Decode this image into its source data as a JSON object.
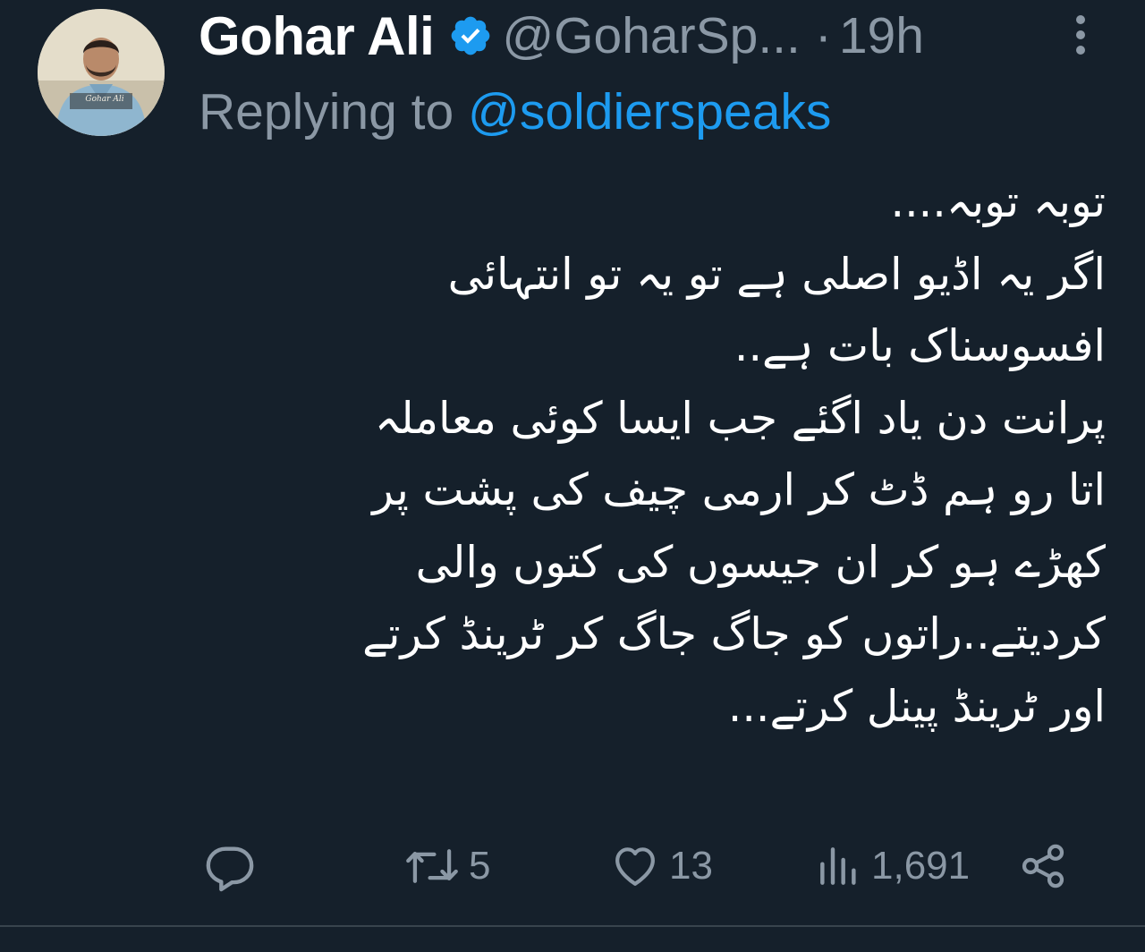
{
  "author": {
    "name": "Gohar Ali",
    "handle": "@GoharSp...",
    "separator": "·",
    "time": "19h",
    "avatar_caption": "Gohar Ali"
  },
  "reply": {
    "prefix": "Replying to ",
    "mention": "@soldierspeaks"
  },
  "tweet": {
    "lines": [
      "توبہ توبہ....",
      "اگر یہ اڈیو اصلی ہے تو یہ تو انتہائی",
      "افسوسناک بات ہے..",
      "پرانت دن یاد اگئے جب ایسا کوئی معاملہ",
      "اتا رو ہم ڈٹ کر ارمی چیف کی پشت پر",
      "کھڑے ہو کر ان جیسوں کی کتوں والی",
      "کردیتے..راتوں کو جاگ جاگ کر ٹرینڈ کرتے",
      "اور ٹرینڈ پینل کرتے..."
    ]
  },
  "actions": {
    "reply_icon": "reply-icon",
    "retweet_icon": "retweet-icon",
    "retweet_count": "5",
    "like_icon": "heart-icon",
    "like_count": "13",
    "views_icon": "views-icon",
    "views_count": "1,691",
    "share_icon": "share-icon"
  },
  "colors": {
    "background": "#15202b",
    "text_primary": "#ffffff",
    "text_secondary": "#8b98a5",
    "accent": "#1d9bf0",
    "divider": "#38444d"
  }
}
